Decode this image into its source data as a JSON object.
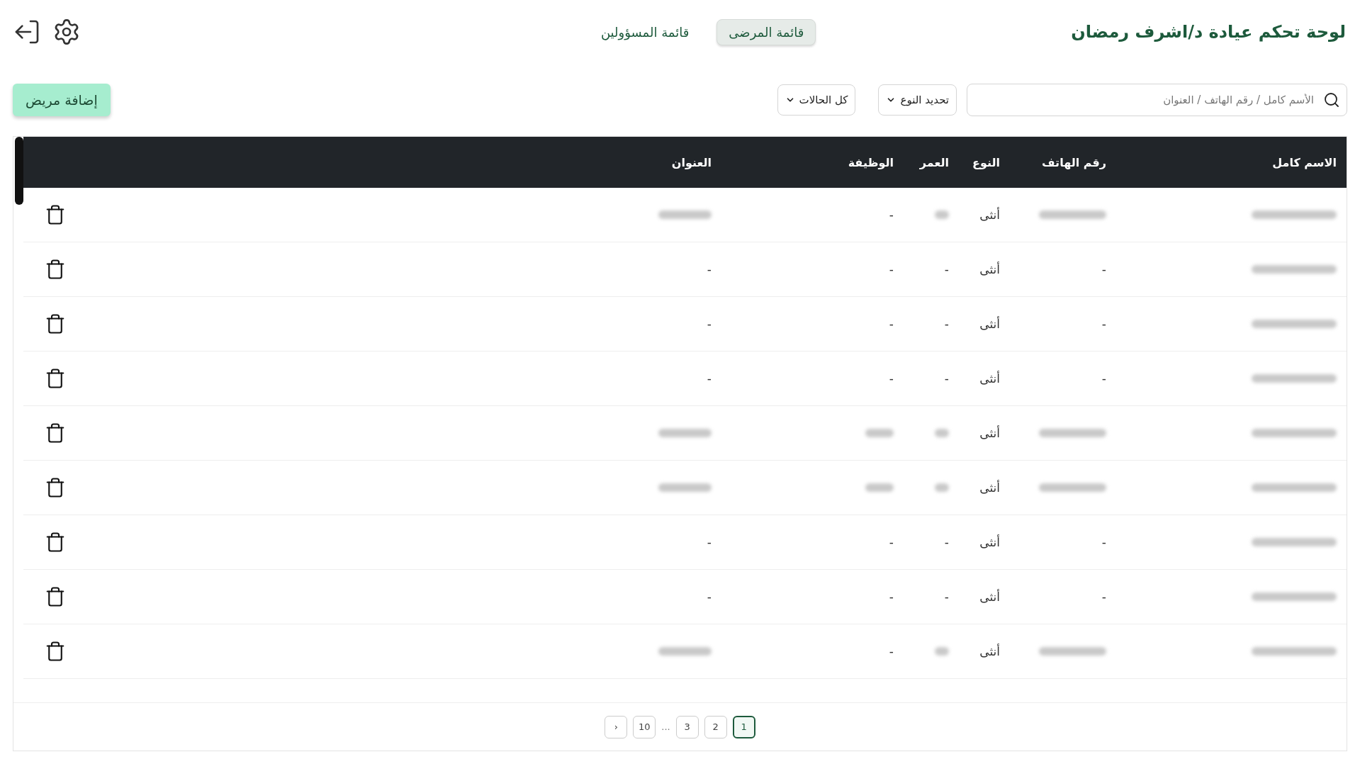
{
  "header": {
    "title": "لوحة تحكم عيادة د/اشرف رمضان",
    "tabs": [
      {
        "label": "قائمة المرضى",
        "selected": true
      },
      {
        "label": "قائمة المسؤولين",
        "selected": false
      }
    ]
  },
  "filters": {
    "search": {
      "placeholder": "الأسم كامل / رقم الهاتف / العنوان"
    },
    "selects": [
      {
        "value": "تحديد النوع"
      },
      {
        "value": "كل الحالات"
      }
    ],
    "add_button": "إضافة مريض"
  },
  "table": {
    "columns": [
      "الاسم كامل",
      "رقم الهاتف",
      "النوع",
      "العمر",
      "الوظيفة",
      "العنوان"
    ],
    "rows": [
      {
        "cells": [
          {
            "blurred": true
          },
          {
            "blurred": true
          },
          {
            "text": "أنثى"
          },
          {
            "blurred": true
          },
          {
            "text": "-"
          },
          {
            "blurred": true
          }
        ]
      },
      {
        "cells": [
          {
            "blurred": true
          },
          {
            "text": "-"
          },
          {
            "text": "أنثى"
          },
          {
            "text": "-"
          },
          {
            "text": "-"
          },
          {
            "text": "-"
          }
        ]
      },
      {
        "cells": [
          {
            "blurred": true
          },
          {
            "text": "-"
          },
          {
            "text": "أنثى"
          },
          {
            "text": "-"
          },
          {
            "text": "-"
          },
          {
            "text": "-"
          }
        ]
      },
      {
        "cells": [
          {
            "blurred": true
          },
          {
            "text": "-"
          },
          {
            "text": "أنثى"
          },
          {
            "text": "-"
          },
          {
            "text": "-"
          },
          {
            "text": "-"
          }
        ]
      },
      {
        "cells": [
          {
            "blurred": true
          },
          {
            "blurred": true
          },
          {
            "text": "أنثى"
          },
          {
            "blurred": true
          },
          {
            "blurred": true
          },
          {
            "blurred": true
          }
        ]
      },
      {
        "cells": [
          {
            "blurred": true
          },
          {
            "blurred": true
          },
          {
            "text": "أنثى"
          },
          {
            "blurred": true
          },
          {
            "blurred": true
          },
          {
            "blurred": true
          }
        ]
      },
      {
        "cells": [
          {
            "blurred": true
          },
          {
            "text": "-"
          },
          {
            "text": "أنثى"
          },
          {
            "text": "-"
          },
          {
            "text": "-"
          },
          {
            "text": "-"
          }
        ]
      },
      {
        "cells": [
          {
            "blurred": true
          },
          {
            "text": "-"
          },
          {
            "text": "أنثى"
          },
          {
            "text": "-"
          },
          {
            "text": "-"
          },
          {
            "text": "-"
          }
        ]
      },
      {
        "cells": [
          {
            "blurred": true
          },
          {
            "blurred": true
          },
          {
            "text": "أنثى"
          },
          {
            "blurred": true
          },
          {
            "text": "-"
          },
          {
            "blurred": true
          }
        ]
      }
    ]
  },
  "pagination": {
    "items": [
      {
        "kind": "page",
        "label": "1",
        "selected": true
      },
      {
        "kind": "page",
        "label": "2",
        "selected": false
      },
      {
        "kind": "page",
        "label": "3",
        "selected": false
      },
      {
        "kind": "ellipsis",
        "label": "..."
      },
      {
        "kind": "page",
        "label": "10",
        "selected": false
      },
      {
        "kind": "arrow",
        "label": "‹",
        "selected": false
      }
    ]
  }
}
